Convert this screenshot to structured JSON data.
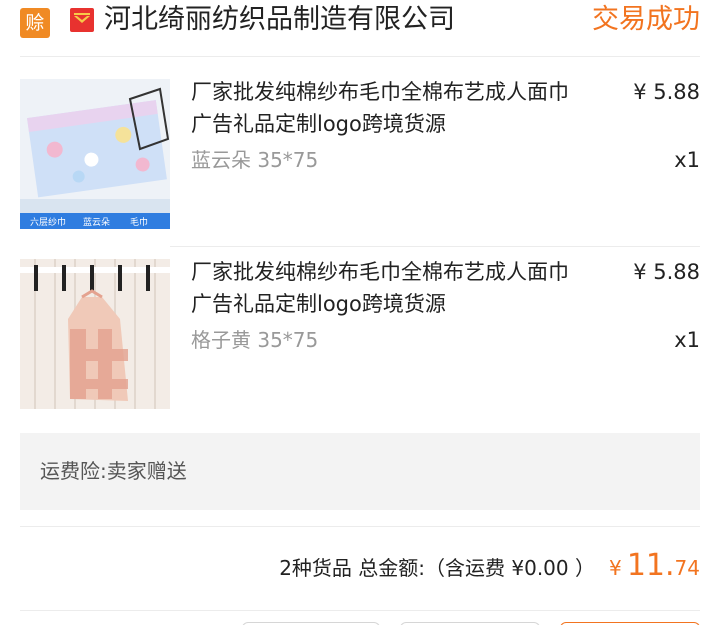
{
  "header": {
    "badge_label": "赊",
    "shop_icon": "shop-logo-icon",
    "shop_name": "河北绮丽纺织品制造有限公司",
    "status": "交易成功"
  },
  "colors": {
    "accent": "#f27420",
    "badge": "#f08a24",
    "panel": "#f3f3f3"
  },
  "items": [
    {
      "title_line1": "厂家批发纯棉纱布毛巾全棉布艺成人面巾",
      "title_line2": "广告礼品定制logo跨境货源",
      "price": "¥ 5.88",
      "spec": "蓝云朵 35*75",
      "qty": "x1",
      "image_labels": [
        "六层纱巾",
        "蓝云朵",
        "毛巾"
      ]
    },
    {
      "title_line1": "厂家批发纯棉纱布毛巾全棉布艺成人面巾",
      "title_line2": "广告礼品定制logo跨境货源",
      "price": "¥ 5.88",
      "spec": "格子黄 35*75",
      "qty": "x1"
    }
  ],
  "insurance": {
    "label": "运费险:卖家赠送"
  },
  "summary": {
    "text": "2种货品 总金额:（含运费 ¥0.00 ）",
    "currency": "¥",
    "amount_int": "11.",
    "amount_dec": "74"
  }
}
